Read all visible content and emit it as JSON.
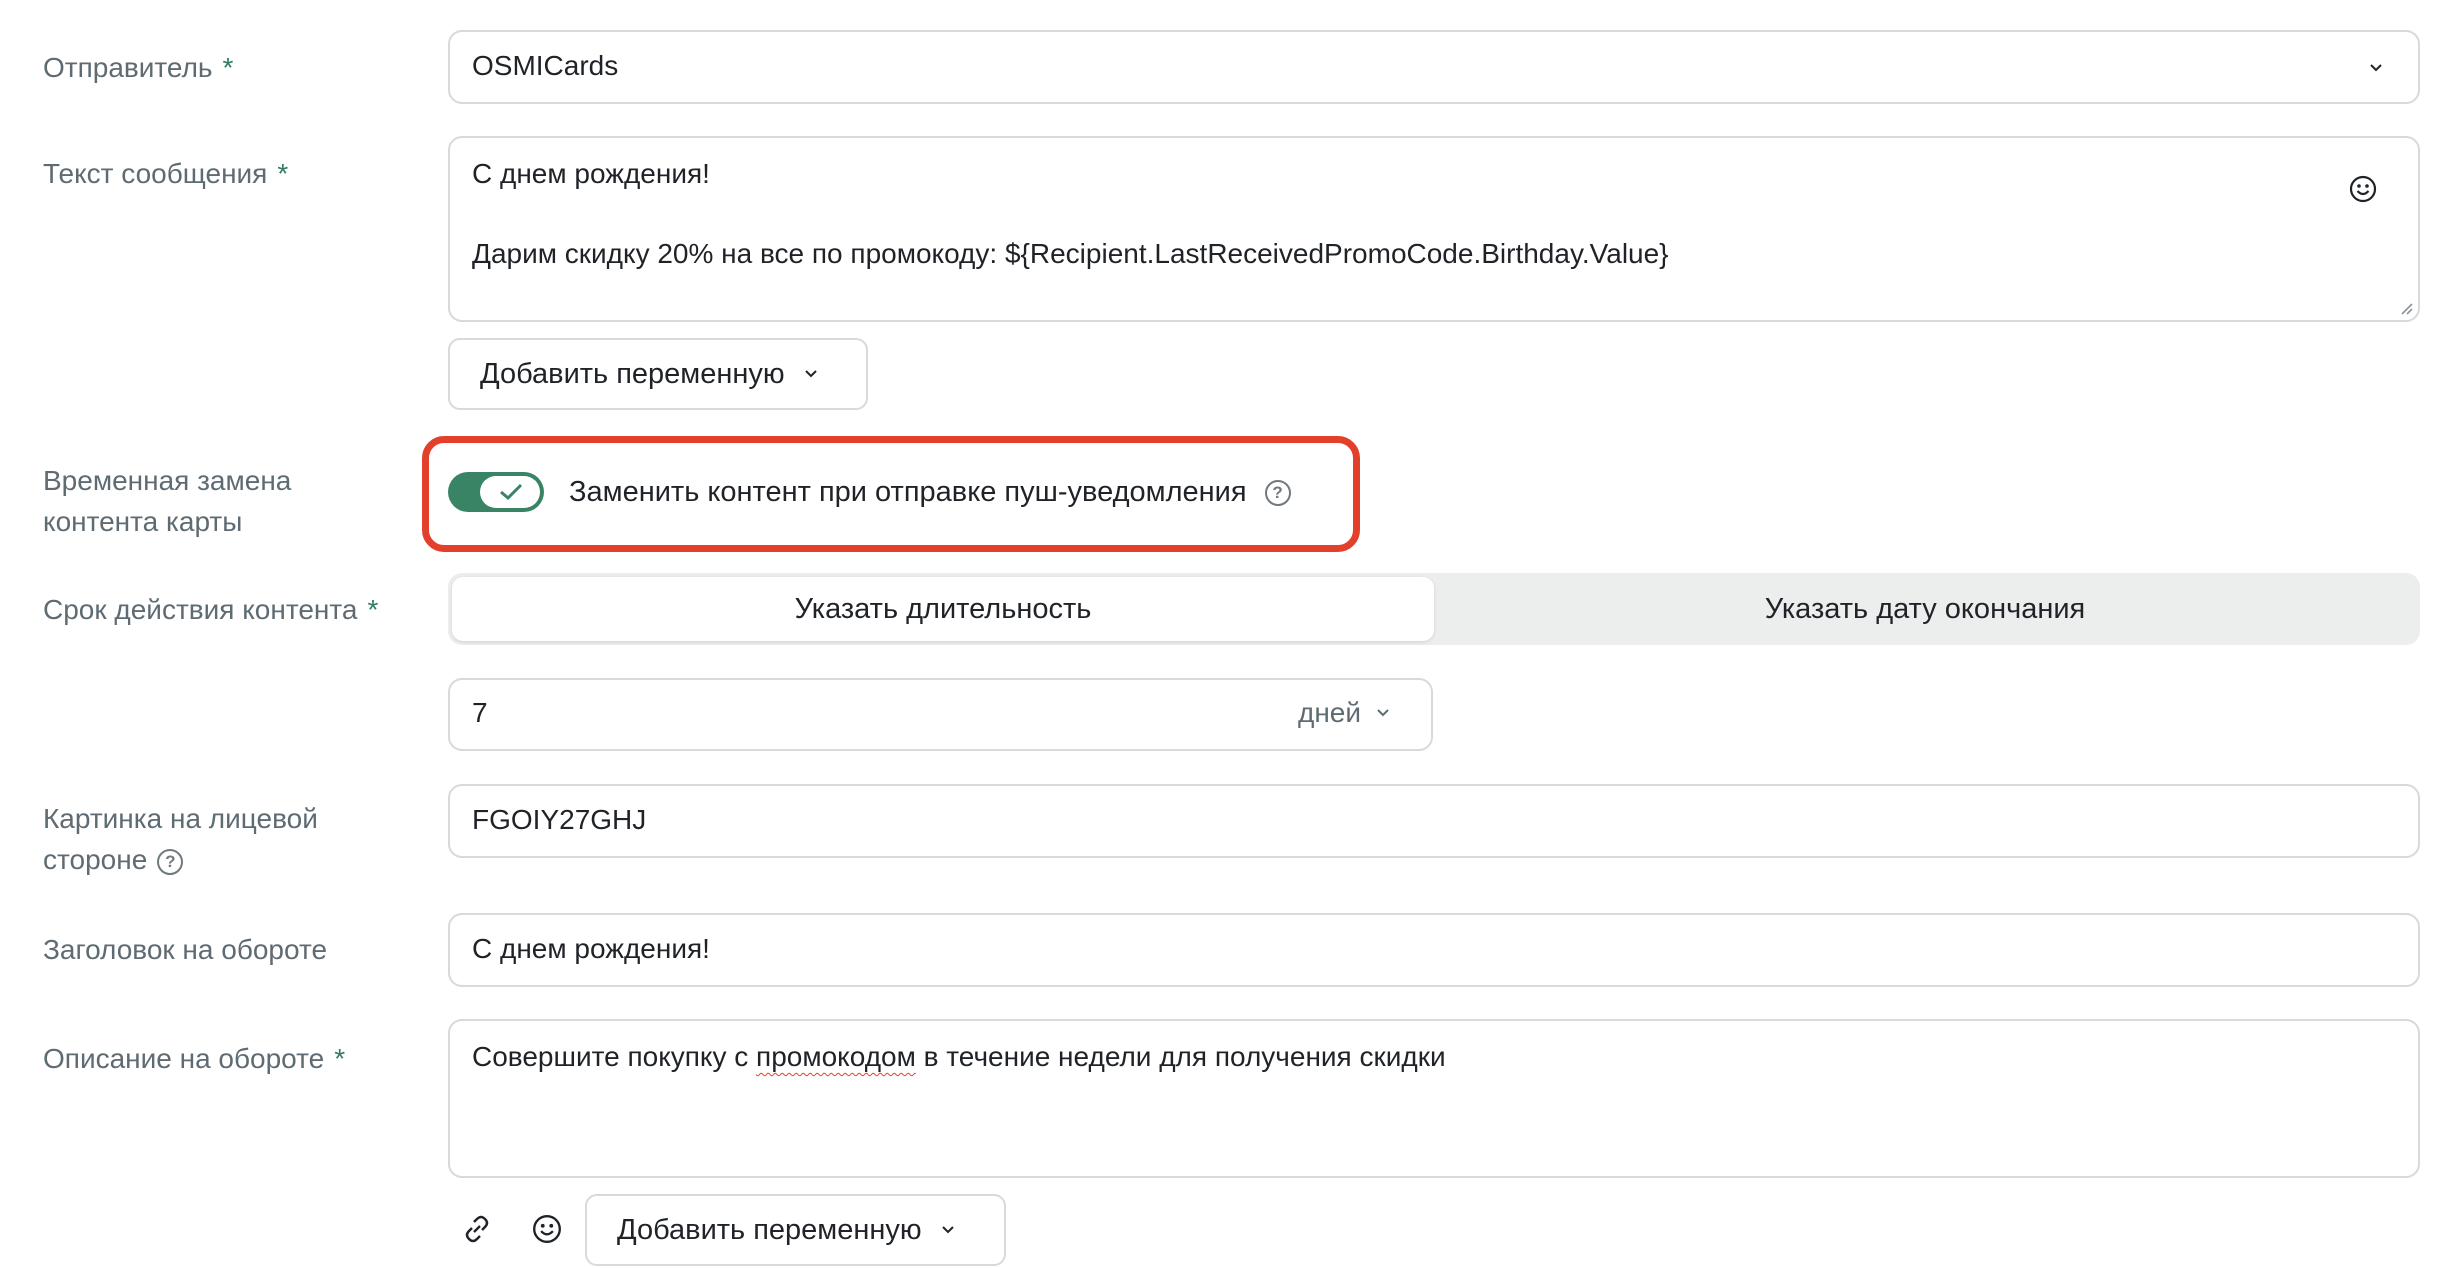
{
  "sender": {
    "label": "Отправитель",
    "required": "*",
    "value": "OSMICards"
  },
  "message": {
    "label": "Текст сообщения",
    "required": "*",
    "line1": "С днем рождения!",
    "line2": "Дарим скидку 20% на все по промокоду: ${Recipient.LastReceivedPromoCode.Birthday.Value}",
    "add_variable": "Добавить переменную"
  },
  "temp_replace": {
    "label_line1": "Временная замена",
    "label_line2": "контента карты",
    "toggle_label": "Заменить контент при отправке пуш-уведомления",
    "toggle_on": true
  },
  "validity": {
    "label": "Срок действия контента",
    "required": "*",
    "tabs": [
      "Указать длительность",
      "Указать дату окончания"
    ],
    "active_tab": 0,
    "duration_value": "7",
    "duration_unit": "дней"
  },
  "front_image": {
    "label_line1": "Картинка на лицевой",
    "label_line2": "стороне",
    "value": "FGOIY27GHJ"
  },
  "back_title": {
    "label": "Заголовок на обороте",
    "value": "С днем рождения!"
  },
  "back_description": {
    "label": "Описание на обороте",
    "required": "*",
    "value_before": "Совершите покупку с ",
    "value_misspelled": "промокодом",
    "value_after": " в течение недели для получения скидки",
    "add_variable": "Добавить переменную"
  },
  "colors": {
    "accent": "#3a8466",
    "highlight": "#e2402b",
    "label": "#5f6b72"
  }
}
